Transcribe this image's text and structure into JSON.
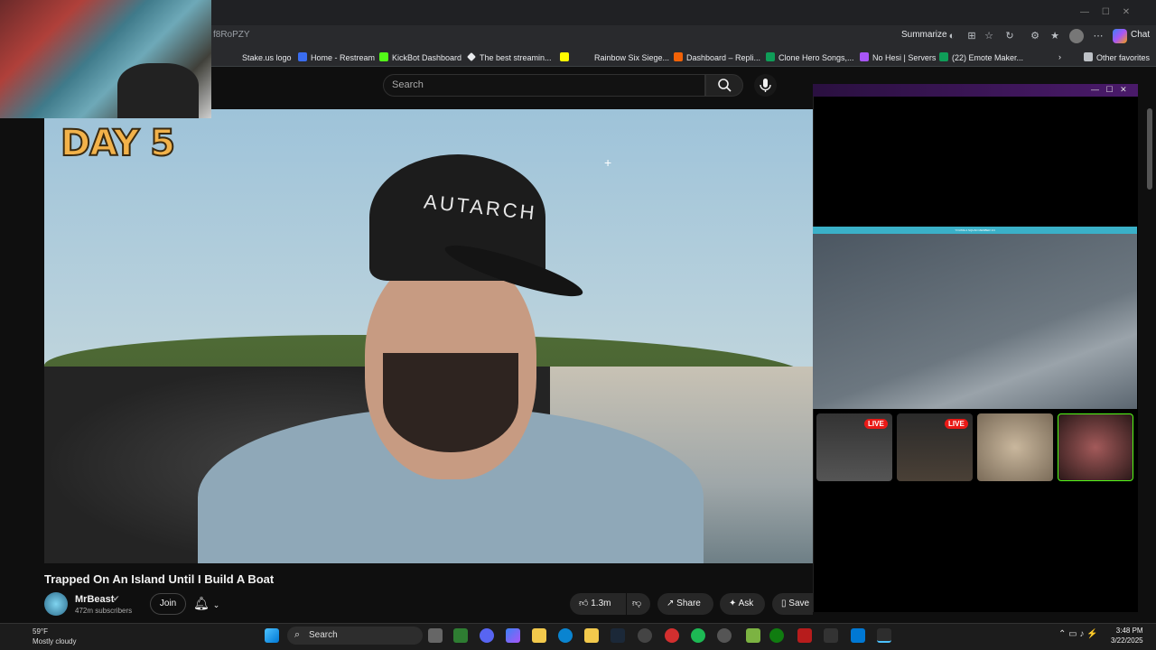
{
  "browser": {
    "url_fragment": "f8RoPZY",
    "summarize_label": "Summarize",
    "chat_label": "Chat",
    "bookmarks": [
      {
        "label": "Stake.us logo",
        "icon": "stake-icon",
        "color": "#e8eaed"
      },
      {
        "label": "Home - Restream",
        "icon": "restream-icon",
        "color": "#3a6df0"
      },
      {
        "label": "KickBot Dashboard",
        "icon": "kickbot-icon",
        "color": "#53fc18"
      },
      {
        "label": "The best streamin...",
        "icon": "diamond-icon",
        "color": "#e8eaed"
      },
      {
        "label": "",
        "icon": "snapchat-icon",
        "color": "#fffc00"
      },
      {
        "label": "Rainbow Six Siege...",
        "icon": "r6-icon",
        "color": "#e8eaed"
      },
      {
        "label": "Dashboard – Repli...",
        "icon": "replit-icon",
        "color": "#f26207"
      },
      {
        "label": "Clone Hero Songs,...",
        "icon": "sheets-icon",
        "color": "#0f9d58"
      },
      {
        "label": "No Hesi | Servers",
        "icon": "nohesi-icon",
        "color": "#a855f7"
      },
      {
        "label": "(22) Emote Maker...",
        "icon": "emote-icon",
        "color": "#0f9d58"
      }
    ],
    "other_favorites_label": "Other favorites"
  },
  "youtube": {
    "search_placeholder": "Search",
    "video": {
      "overlay_text": "DAY 5",
      "cap_text": "AUTARCH",
      "title": "Trapped On An Island Until I Build A Boat",
      "channel": "MrBeast",
      "subscribers": "472m subscribers",
      "join_label": "Join",
      "likes": "1.3m",
      "share_label": "Share",
      "ask_label": "Ask",
      "save_label": "Save"
    }
  },
  "pip": {
    "game_header": "YOU'RE A SQUAD MEMBER 1/4",
    "live_badge": "LIVE"
  },
  "taskbar": {
    "weather": "59°F",
    "weather_desc": "Mostly cloudy",
    "search_label": "Search",
    "time": "3:48 PM",
    "date": "3/22/2025"
  }
}
